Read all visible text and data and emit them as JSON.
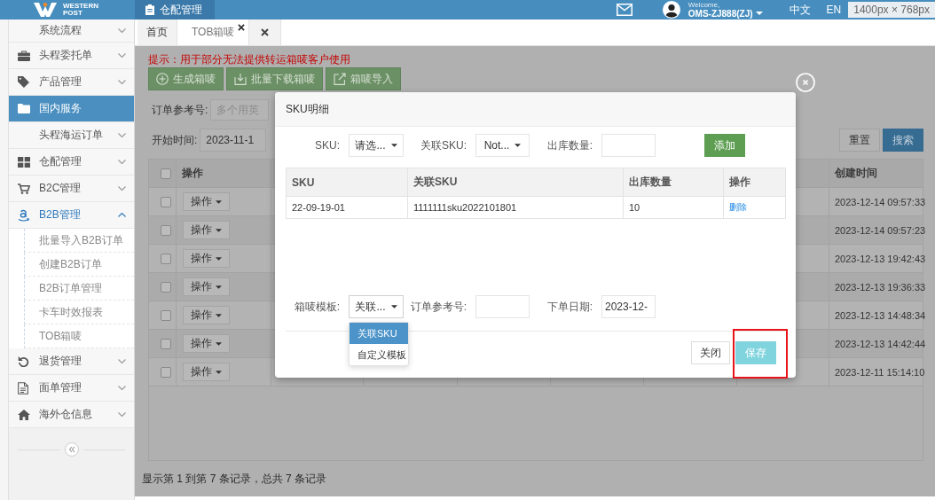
{
  "header": {
    "logo_text": "WESTERN POST",
    "module": {
      "label": "仓配管理",
      "selected": true
    },
    "user": {
      "greeting": "Welcome,",
      "name": "OMS-ZJ888(ZJ)"
    },
    "languages": [
      "中文",
      "EN"
    ],
    "size_readout": "1400px × 768px"
  },
  "sidebar": {
    "items": [
      {
        "label": "系统流程",
        "kind": "group",
        "selected": false,
        "expanded": false
      },
      {
        "label": "头程委托单",
        "kind": "group",
        "selected": false,
        "expanded": false
      },
      {
        "label": "产品管理",
        "kind": "group",
        "selected": false,
        "expanded": false
      },
      {
        "label": "国内服务",
        "kind": "link",
        "selected": true
      },
      {
        "label": "头程海运订单",
        "kind": "group",
        "selected": false,
        "expanded": false
      },
      {
        "label": "仓配管理",
        "kind": "group",
        "selected": false,
        "expanded": false
      },
      {
        "label": "B2C管理",
        "kind": "group",
        "selected": false,
        "expanded": false
      },
      {
        "label": "B2B管理",
        "kind": "group",
        "selected": false,
        "expanded": true,
        "children": [
          {
            "label": "批量导入B2B订单",
            "selected": false
          },
          {
            "label": "创建B2B订单",
            "selected": false
          },
          {
            "label": "B2B订单管理",
            "selected": false
          },
          {
            "label": "卡车时效报表",
            "selected": false
          },
          {
            "label": "TOB箱唛",
            "selected": false
          }
        ]
      },
      {
        "label": "退货管理",
        "kind": "group",
        "selected": false,
        "expanded": false
      },
      {
        "label": "面单管理",
        "kind": "group",
        "selected": false,
        "expanded": false
      },
      {
        "label": "海外仓信息",
        "kind": "group",
        "selected": false,
        "expanded": false
      }
    ]
  },
  "tabs": [
    {
      "label": "首页",
      "selected": false,
      "closable": false
    },
    {
      "label": "TOB箱唛",
      "selected": true,
      "closable": true
    }
  ],
  "content": {
    "hint": "提示：用于部分无法提供转运箱唛客户使用",
    "actions": [
      "生成箱唛",
      "批量下载箱唛",
      "箱唛导入"
    ],
    "filters": [
      {
        "label": "订单参考号:",
        "placeholder": "多个用英"
      },
      {
        "label": "开始时间:",
        "value": "2023-11-1"
      }
    ],
    "buttons": [
      {
        "label": "重置",
        "kind": "default"
      },
      {
        "label": "搜索",
        "kind": "primary"
      }
    ],
    "table": {
      "header_checked": false,
      "columns": [
        "操作",
        "创建时间"
      ],
      "rows": [
        {
          "checked": false,
          "action": "操作",
          "created_at": "2023-12-14 09:57:33"
        },
        {
          "checked": false,
          "action": "操作",
          "created_at": "2023-12-14 09:57:23"
        },
        {
          "checked": false,
          "action": "操作",
          "created_at": "2023-12-13 19:42:43"
        },
        {
          "checked": false,
          "action": "操作",
          "created_at": "2023-12-13 19:36:33"
        },
        {
          "checked": false,
          "action": "操作",
          "created_at": "2023-12-13 14:48:34"
        },
        {
          "checked": false,
          "action": "操作",
          "created_at": "2023-12-13 14:42:44"
        },
        {
          "checked": false,
          "action": "操作",
          "created_at": "2023-12-11 15:14:10"
        }
      ]
    },
    "summary": "显示第 1 到第 7 条记录，总共 7 条记录"
  },
  "modal": {
    "title": "SKU明细",
    "sku_fields": [
      {
        "label": "SKU:",
        "kind": "select",
        "value": "请选...",
        "expanded": false
      },
      {
        "label": "关联SKU:",
        "kind": "select",
        "value": "Not...",
        "expanded": false
      },
      {
        "label": "出库数量:",
        "kind": "input"
      }
    ],
    "add_button": "添加",
    "table": {
      "columns": [
        "SKU",
        "关联SKU",
        "出库数量",
        "操作"
      ],
      "rows": [
        {
          "sku": "22-09-19-01",
          "linked_sku": "1111111sku2022101801",
          "quantity": "10",
          "action": "删除"
        }
      ]
    },
    "order_fields": [
      {
        "label": "箱唛模板:",
        "kind": "select",
        "value": "关联...",
        "expanded": true,
        "menu": [
          {
            "label": "关联SKU",
            "selected": true
          },
          {
            "label": "自定义模板",
            "selected": false
          }
        ]
      },
      {
        "label": "订单参考号:",
        "kind": "input"
      },
      {
        "label": "下单日期:",
        "kind": "input",
        "value": "2023-12-"
      }
    ],
    "buttons": [
      {
        "label": "关闭",
        "kind": "default",
        "highlighted": false
      },
      {
        "label": "保存",
        "kind": "info",
        "highlighted": true
      }
    ]
  }
}
